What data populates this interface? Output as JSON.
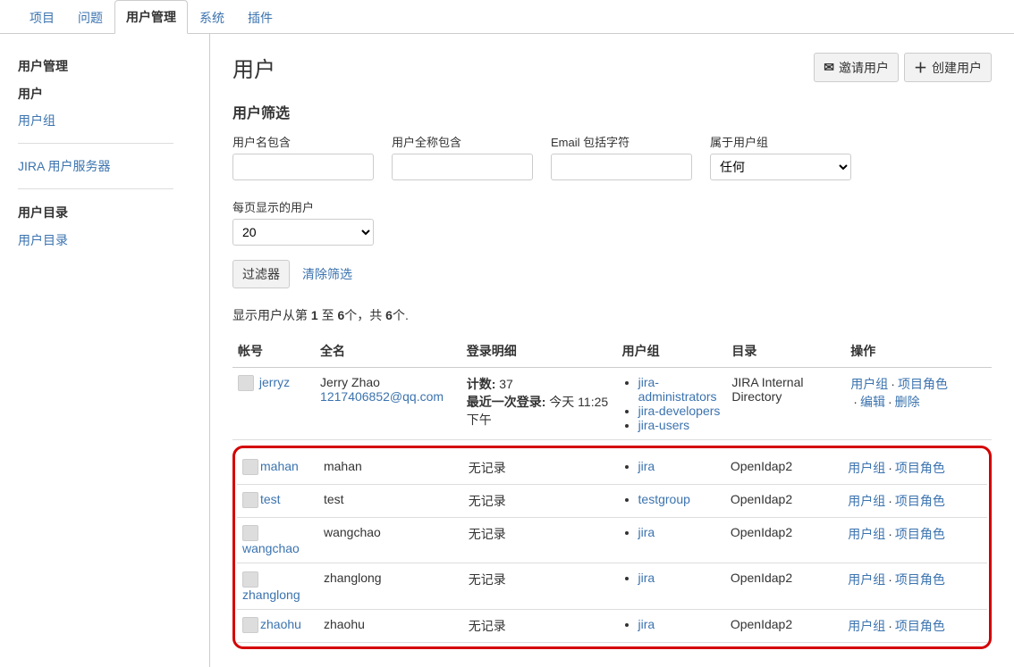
{
  "topnav": {
    "items": [
      "项目",
      "问题",
      "用户管理",
      "系统",
      "插件"
    ],
    "activeIndex": 2
  },
  "sidebar": {
    "section1_heading": "用户管理",
    "items1": [
      "用户",
      "用户组"
    ],
    "selectedIndex1": 0,
    "jira_user_server": "JIRA 用户服务器",
    "section2_heading": "用户目录",
    "items2": [
      "用户目录"
    ]
  },
  "page": {
    "title": "用户",
    "invite_btn": "邀请用户",
    "create_btn": "创建用户"
  },
  "filter": {
    "heading": "用户筛选",
    "username_label": "用户名包含",
    "fullname_label": "用户全称包含",
    "email_label": "Email 包括字符",
    "group_label": "属于用户组",
    "group_value": "任何",
    "perpage_label": "每页显示的用户",
    "perpage_value": "20",
    "filter_btn": "过滤器",
    "clear_link": "清除筛选"
  },
  "summary": {
    "prefix": "显示用户从第 ",
    "from": "1",
    "mid": " 至 ",
    "to": "6",
    "mid2": "个，共 ",
    "total": "6",
    "suffix": "个."
  },
  "table": {
    "headers": {
      "account": "帐号",
      "fullname": "全名",
      "login": "登录明细",
      "groups": "用户组",
      "directory": "目录",
      "actions": "操作"
    },
    "row1": {
      "account": "jerryz",
      "fullname": "Jerry Zhao",
      "email": "1217406852@qq.com",
      "login_count_label": "计数:",
      "login_count": "37",
      "last_login_label": "最近一次登录:",
      "last_login_value": "今天 11:25 下午",
      "groups": [
        "jira-administrators",
        "jira-developers",
        "jira-users"
      ],
      "directory": "JIRA Internal Directory",
      "actions": {
        "groups": "用户组",
        "roles": "项目角色",
        "edit": "编辑",
        "delete": "删除"
      }
    },
    "rows": [
      {
        "account": "mahan",
        "fullname": "mahan",
        "login": "无记录",
        "groups": [
          "jira"
        ],
        "directory": "OpenIdap2",
        "actions": {
          "groups": "用户组",
          "roles": "项目角色"
        }
      },
      {
        "account": "test",
        "fullname": "test",
        "login": "无记录",
        "groups": [
          "testgroup"
        ],
        "directory": "OpenIdap2",
        "actions": {
          "groups": "用户组",
          "roles": "项目角色"
        }
      },
      {
        "account": "wangchao",
        "fullname": "wangchao",
        "login": "无记录",
        "groups": [
          "jira"
        ],
        "directory": "OpenIdap2",
        "actions": {
          "groups": "用户组",
          "roles": "项目角色"
        }
      },
      {
        "account": "zhanglong",
        "fullname": "zhanglong",
        "login": "无记录",
        "groups": [
          "jira"
        ],
        "directory": "OpenIdap2",
        "actions": {
          "groups": "用户组",
          "roles": "项目角色"
        }
      },
      {
        "account": "zhaohu",
        "fullname": "zhaohu",
        "login": "无记录",
        "groups": [
          "jira"
        ],
        "directory": "OpenIdap2",
        "actions": {
          "groups": "用户组",
          "roles": "项目角色"
        }
      }
    ]
  }
}
